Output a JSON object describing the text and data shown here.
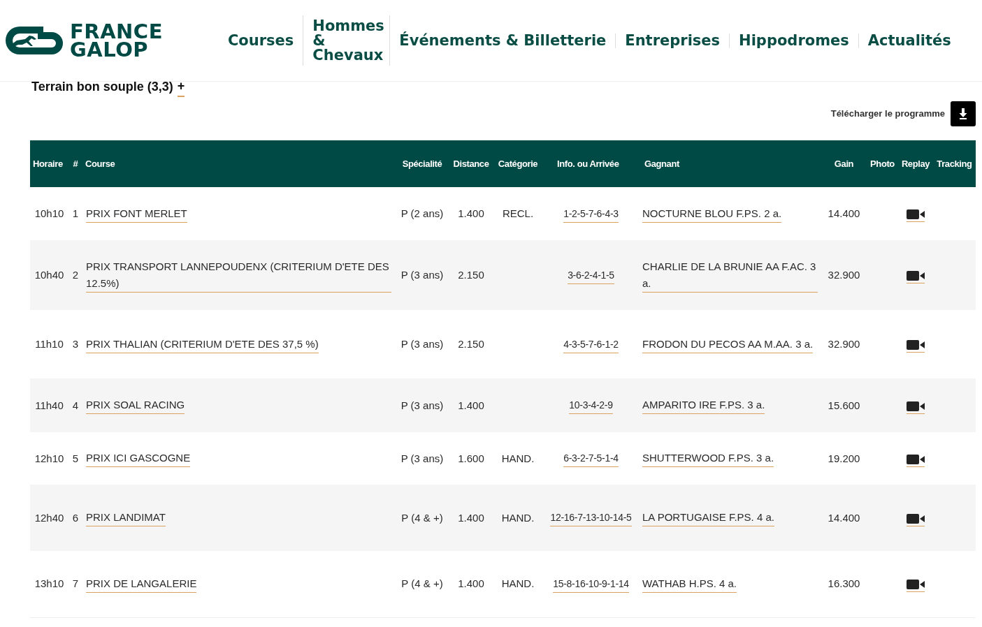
{
  "header": {
    "logo_lines": [
      "FRANCE",
      "GALOP"
    ],
    "nav": [
      {
        "label": "Courses"
      },
      {
        "label": "Hommes & Chevaux"
      },
      {
        "label": "Événements & Billetterie"
      },
      {
        "label": "Entreprises"
      },
      {
        "label": "Hippodromes"
      },
      {
        "label": "Actualités"
      }
    ]
  },
  "terrain": {
    "text": "Terrain bon souple (3,3)",
    "toggle": "+"
  },
  "download": {
    "label": "Télécharger le programme"
  },
  "table": {
    "columns": [
      "Horaire",
      "#",
      "Course",
      "Spécialité",
      "Distance",
      "Catégorie",
      "Info. ou Arrivée",
      "Gagnant",
      "Gain",
      "Photo",
      "Replay",
      "Tracking"
    ],
    "rows": [
      {
        "time": "10h10",
        "number": "1",
        "course": "PRIX FONT MERLET",
        "specialite": "P (2 ans)",
        "distance": "1.400",
        "categorie": "RECL.",
        "arrivee": "1-2-5-7-6-4-3",
        "gagnant": "NOCTURNE BLOU F.PS. 2 a.",
        "gain": "14.400",
        "replay": true
      },
      {
        "time": "10h40",
        "number": "2",
        "course": "PRIX TRANSPORT LANNEPOUDENX (CRITERIUM D'ETE DES 12.5%)",
        "specialite": "P (3 ans)",
        "distance": "2.150",
        "arrivee": "3-6-2-4-1-5",
        "gagnant": "CHARLIE DE LA BRUNIE AA F.AC. 3 a.",
        "gain": "32.900",
        "replay": true
      },
      {
        "time": "11h10",
        "number": "3",
        "course": "PRIX THALIAN (CRITERIUM D'ETE DES 37,5 %)",
        "specialite": "P (3 ans)",
        "distance": "2.150",
        "arrivee": "4-3-5-7-6-1-2",
        "gagnant": "FRODON DU PECOS AA M.AA. 3 a.",
        "gain": "32.900",
        "replay": true
      },
      {
        "time": "11h40",
        "number": "4",
        "course": "PRIX SOAL RACING",
        "specialite": "P (3 ans)",
        "distance": "1.400",
        "arrivee": "10-3-4-2-9",
        "gagnant": "AMPARITO IRE F.PS. 3 a.",
        "gain": "15.600",
        "replay": true
      },
      {
        "time": "12h10",
        "number": "5",
        "course": "PRIX ICI GASCOGNE",
        "specialite": "P (3 ans)",
        "distance": "1.600",
        "categorie": "HAND.",
        "arrivee": "6-3-2-7-5-1-4",
        "gagnant": "SHUTTERWOOD F.PS. 3 a.",
        "gain": "19.200",
        "replay": true
      },
      {
        "time": "12h40",
        "number": "6",
        "course": "PRIX LANDIMAT",
        "specialite": "P (4 & +)",
        "distance": "1.400",
        "categorie": "HAND.",
        "arrivee": "12-16-7-13-10-14-5",
        "gagnant": "LA PORTUGAISE F.PS. 4 a.",
        "gain": "14.400",
        "replay": true
      },
      {
        "time": "13h10",
        "number": "7",
        "course": "PRIX DE LANGALERIE",
        "specialite": "P (4 & +)",
        "distance": "1.400",
        "categorie": "HAND.",
        "arrivee": "15-8-16-10-9-1-14",
        "gagnant": "WATHAB H.PS. 4 a.",
        "gain": "16.300",
        "replay": true
      }
    ]
  }
}
